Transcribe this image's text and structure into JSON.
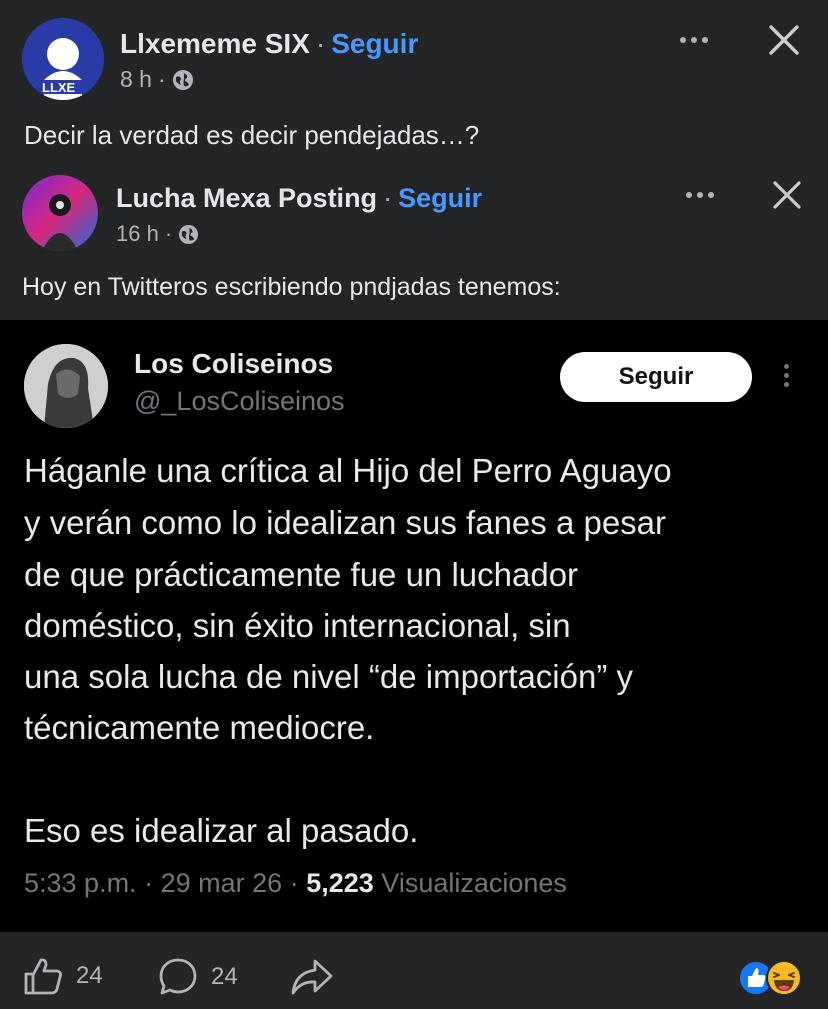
{
  "post": {
    "author": "Llxememe SIX",
    "sep": "·",
    "follow_label": "Seguir",
    "time": "8 h",
    "time_sep": "·",
    "text": "Decir la verdad es decir pendejadas…?"
  },
  "shared_post": {
    "author": "Lucha Mexa Posting",
    "sep": "·",
    "follow_label": "Seguir",
    "time": "16 h",
    "time_sep": "·",
    "text": "Hoy en Twitteros escribiendo pndjadas tenemos:"
  },
  "tweet": {
    "name": "Los Coliseinos",
    "handle": "@_LosColiseinos",
    "follow_label": "Seguir",
    "lines": [
      "Háganle una crítica al Hijo del Perro Aguayo",
      "y verán como lo idealizan sus fanes a pesar",
      "de que prácticamente fue un luchador",
      "doméstico, sin éxito internacional, sin",
      "una sola lucha de nivel “de importación” y",
      "técnicamente mediocre.",
      "Eso es idealizar al pasado."
    ],
    "time": "5:33 p.m.",
    "sep1": "·",
    "date": "29 mar 26",
    "sep2": "·",
    "views": "5,223",
    "views_label": "Visualizaciones"
  },
  "actions": {
    "likes": "24",
    "comments": "24"
  },
  "colors": {
    "background": "#242526",
    "tweet_bg": "#000000",
    "accent": "#4599ff",
    "like_blue": "#1877f2",
    "haha_yellow": "#f7b928"
  },
  "icons": [
    "globe-icon",
    "more-icon",
    "close-icon",
    "like-icon",
    "comment-icon",
    "share-icon",
    "reaction-like-icon",
    "reaction-haha-icon"
  ]
}
